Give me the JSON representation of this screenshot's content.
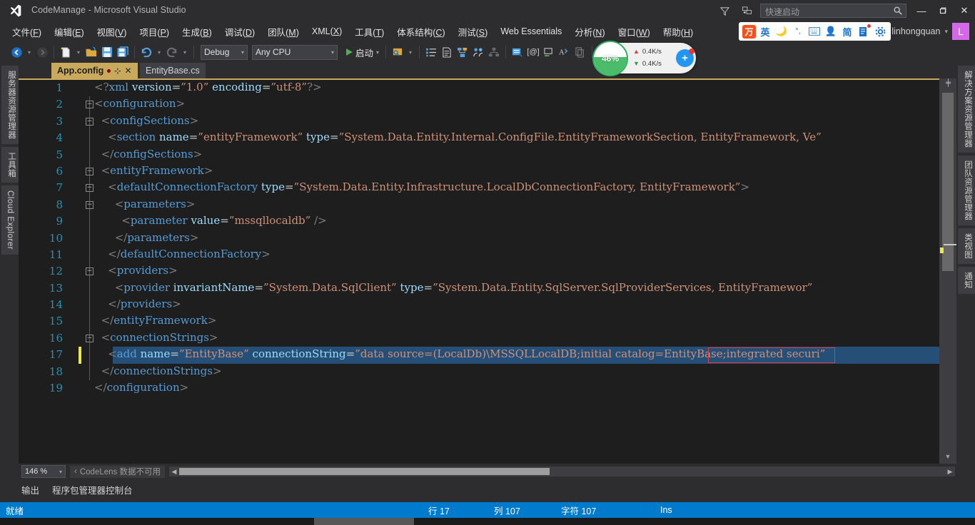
{
  "window": {
    "title": "CodeManage - Microsoft Visual Studio",
    "logo_icon": "visual-studio-logo",
    "minimize_label": "—",
    "maximize_label": "❐",
    "close_label": "✕",
    "feedback_icon": "feedback-icon",
    "filter_icon": "funnel-icon"
  },
  "quick_launch": {
    "placeholder": "快速启动",
    "value": "",
    "icon": "search-icon"
  },
  "menu": {
    "items": [
      {
        "label": "文件(F)",
        "key": "F"
      },
      {
        "label": "编辑(E)",
        "key": "E"
      },
      {
        "label": "视图(V)",
        "key": "V"
      },
      {
        "label": "项目(P)",
        "key": "P"
      },
      {
        "label": "生成(B)",
        "key": "B"
      },
      {
        "label": "调试(D)",
        "key": "D"
      },
      {
        "label": "团队(M)",
        "key": "M"
      },
      {
        "label": "XML(X)",
        "key": "X"
      },
      {
        "label": "工具(T)",
        "key": "T"
      },
      {
        "label": "体系结构(C)",
        "key": "C"
      },
      {
        "label": "测试(S)",
        "key": "S"
      },
      {
        "label": "Web Essentials",
        "key": ""
      },
      {
        "label": "分析(N)",
        "key": "N"
      },
      {
        "label": "窗口(W)",
        "key": "W"
      },
      {
        "label": "帮助(H)",
        "key": "H"
      }
    ]
  },
  "ime": {
    "icons": [
      "sogou-logo",
      "english-mode",
      "moon-icon",
      "punctuation-icon",
      "keyboard-icon",
      "person-icon",
      "simplified-icon",
      "toolbox-icon",
      "settings-gear-icon"
    ],
    "logo_text": "万",
    "english_text": "英",
    "simplified_text": "简"
  },
  "user": {
    "name": "linhongquan",
    "avatar_letter": "L",
    "caret": "▾"
  },
  "toolbar": {
    "back_icon": "navigate-back-icon",
    "forward_icon": "navigate-forward-icon",
    "new_item_icon": "new-item-icon",
    "open_icon": "open-folder-icon",
    "save_icon": "save-icon",
    "save_all_icon": "save-all-icon",
    "undo_icon": "undo-icon",
    "redo_icon": "redo-icon",
    "configuration": {
      "value": "Debug",
      "caret": "▾"
    },
    "platform": {
      "value": "Any CPU",
      "caret": "▾"
    },
    "run_label": "启动",
    "run_icon": "play-icon",
    "extra_icons": [
      "attach-process-icon",
      "bookmark-list-icon",
      "document-outline-icon",
      "class-diagram-icon",
      "sync-views-icon",
      "hierarchy-icon",
      "find-in-files-icon",
      "comment-icon",
      "uncomment-icon",
      "format-icon",
      "copy-icon",
      "indent-icon",
      "history-icon"
    ]
  },
  "net_widget": {
    "percent": "46%",
    "upload": "0.4K/s",
    "download": "0.4K/s",
    "upload_icon": "arrow-up-icon",
    "download_icon": "arrow-down-icon",
    "badge_icon": "plus-badge-icon"
  },
  "dock_left": {
    "tabs": [
      {
        "label": "服务器资源管理器"
      },
      {
        "label": "工具箱"
      },
      {
        "label": "Cloud Explorer"
      }
    ]
  },
  "dock_right": {
    "tabs": [
      {
        "label": "解决方案资源管理器"
      },
      {
        "label": "团队资源管理器"
      },
      {
        "label": "类视图"
      },
      {
        "label": "通知"
      }
    ]
  },
  "document_tabs": [
    {
      "label": "App.config",
      "active": true,
      "dirty": true,
      "pin_icon": "pin-icon",
      "close_icon": "close-icon"
    },
    {
      "label": "EntityBase.cs",
      "active": false,
      "dirty": false
    }
  ],
  "editor": {
    "lines": [
      {
        "num": "1",
        "indent": 0,
        "fold": "",
        "text": "<?xml version=\"1.0\" encoding=\"utf-8\"?>"
      },
      {
        "num": "2",
        "indent": 0,
        "fold": "-",
        "text": "<configuration>"
      },
      {
        "num": "3",
        "indent": 1,
        "fold": "-",
        "text": "  <configSections>"
      },
      {
        "num": "4",
        "indent": 2,
        "fold": "",
        "text": "    <section name=\"entityFramework\" type=\"System.Data.Entity.Internal.ConfigFile.EntityFrameworkSection, EntityFramework, Ve"
      },
      {
        "num": "5",
        "indent": 1,
        "fold": "",
        "text": "  </configSections>"
      },
      {
        "num": "6",
        "indent": 1,
        "fold": "-",
        "text": "  <entityFramework>"
      },
      {
        "num": "7",
        "indent": 2,
        "fold": "-",
        "text": "    <defaultConnectionFactory type=\"System.Data.Entity.Infrastructure.LocalDbConnectionFactory, EntityFramework\">"
      },
      {
        "num": "8",
        "indent": 3,
        "fold": "-",
        "text": "      <parameters>"
      },
      {
        "num": "9",
        "indent": 4,
        "fold": "",
        "text": "        <parameter value=\"mssqllocaldb\" />"
      },
      {
        "num": "10",
        "indent": 3,
        "fold": "",
        "text": "      </parameters>"
      },
      {
        "num": "11",
        "indent": 2,
        "fold": "",
        "text": "    </defaultConnectionFactory>"
      },
      {
        "num": "12",
        "indent": 2,
        "fold": "-",
        "text": "    <providers>"
      },
      {
        "num": "13",
        "indent": 3,
        "fold": "",
        "text": "      <provider invariantName=\"System.Data.SqlClient\" type=\"System.Data.Entity.SqlServer.SqlProviderServices, EntityFramewor"
      },
      {
        "num": "14",
        "indent": 2,
        "fold": "",
        "text": "    </providers>"
      },
      {
        "num": "15",
        "indent": 1,
        "fold": "",
        "text": "  </entityFramework>"
      },
      {
        "num": "16",
        "indent": 1,
        "fold": "-",
        "text": "  <connectionStrings>"
      },
      {
        "num": "17",
        "indent": 2,
        "fold": "",
        "text": "    <add name=\"EntityBase\" connectionString=\"data source=(LocalDb)\\MSSQLLocalDB;initial catalog=EntityBase;integrated securi"
      },
      {
        "num": "18",
        "indent": 1,
        "fold": "",
        "text": "  </connectionStrings>"
      },
      {
        "num": "19",
        "indent": 0,
        "fold": "",
        "text": "</configuration>"
      }
    ],
    "annotation": {
      "text": "catalog=EntityBase",
      "color": "#e23b3b",
      "line": "17"
    },
    "current_line": "17",
    "scroll_up_icon": "scroll-up-arrow",
    "scroll_down_icon": "scroll-down-arrow",
    "split_icon": "split-view-icon"
  },
  "bottom_bar": {
    "zoom": "146 %",
    "zoom_caret": "▾",
    "codelens": "CodeLens 数据不可用",
    "codelens_caret": "‹",
    "hscroll_left_icon": "scroll-left-arrow",
    "hscroll_right_icon": "scroll-right-arrow"
  },
  "output_tabs": [
    {
      "label": "输出"
    },
    {
      "label": "程序包管理器控制台"
    }
  ],
  "status_bar": {
    "ready": "就绪",
    "line": "行 17",
    "column": "列 107",
    "char": "字符 107",
    "insert_mode": "Ins"
  },
  "colors": {
    "accent": "#007acc",
    "active_tab": "#c9a95c",
    "chrome": "#2d2d30",
    "editor_bg": "#1e1e1e",
    "annotation_red": "#e23b3b",
    "change_marker": "#e8e84a"
  }
}
